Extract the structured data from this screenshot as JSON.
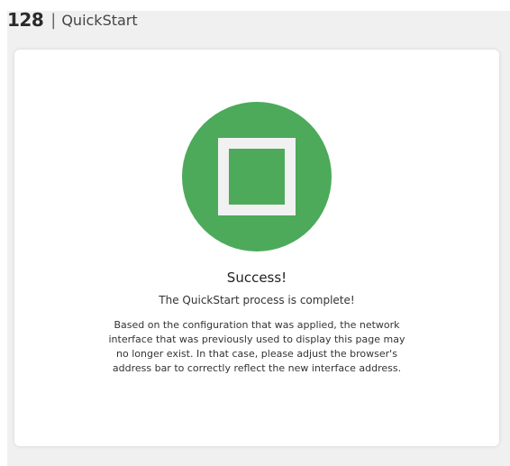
{
  "header": {
    "brand": "128",
    "separator": "|",
    "title": "QuickStart"
  },
  "result": {
    "icon": "square-stop-icon",
    "color": "#4caa5a",
    "title": "Success!",
    "subtitle": "The QuickStart process is complete!",
    "message": "Based on the configuration that was applied, the network interface that was previously used to display this page may no longer exist. In that case, please adjust the browser's address bar to correctly reflect the new interface address."
  }
}
